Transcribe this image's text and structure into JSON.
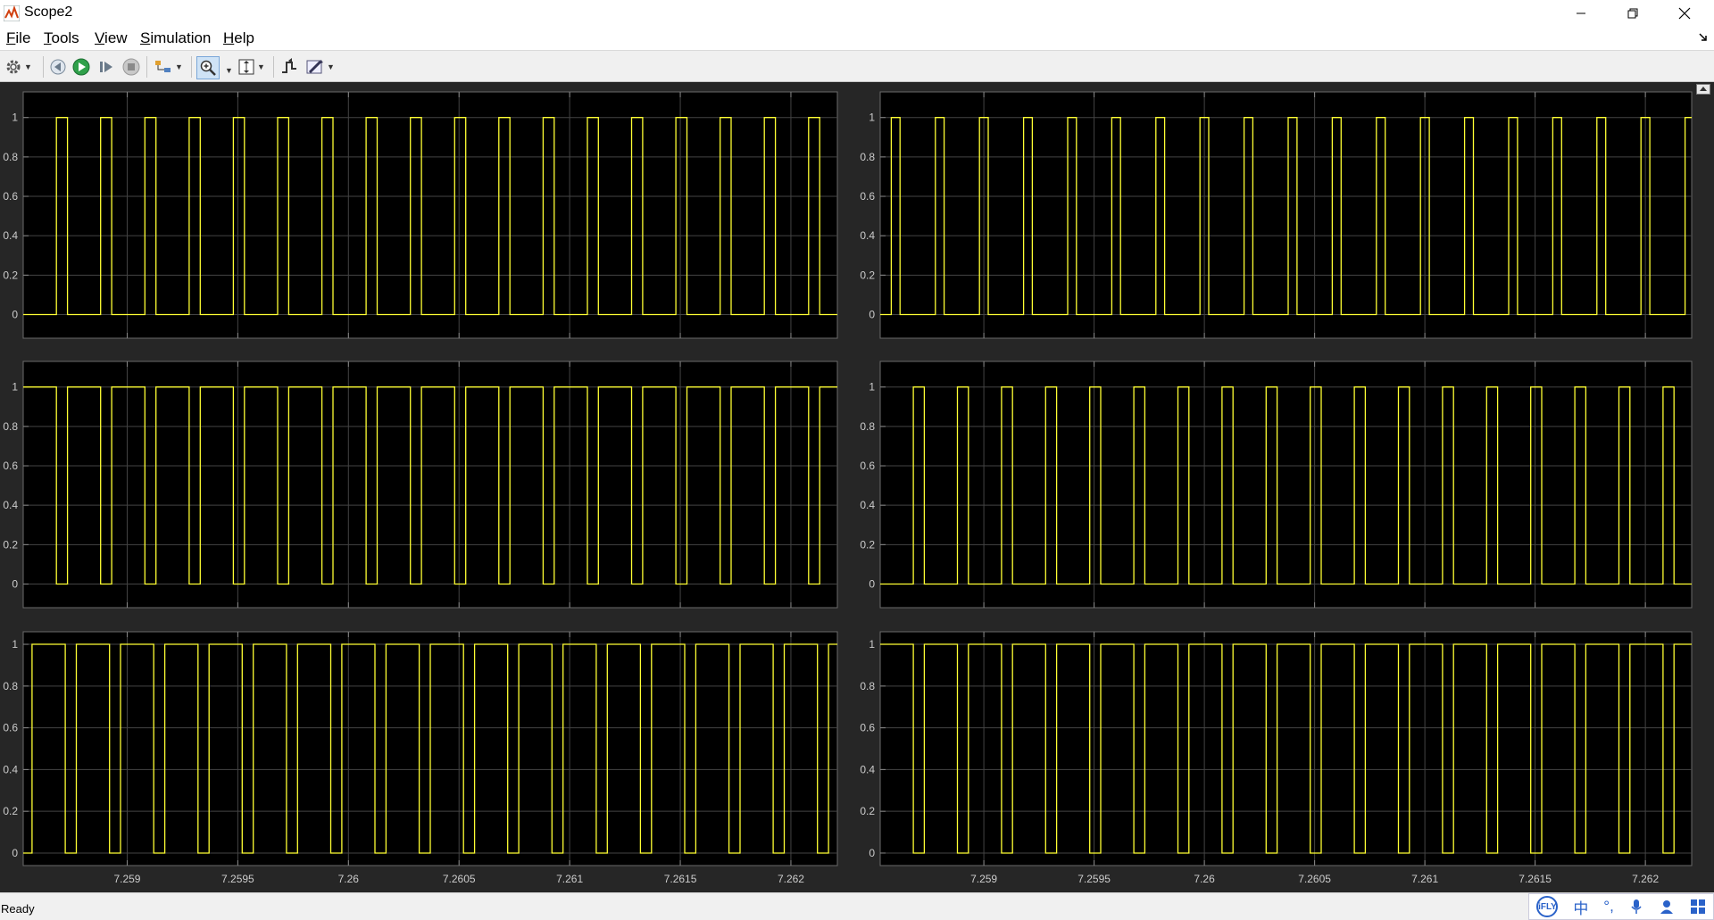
{
  "window": {
    "title": "Scope2"
  },
  "menu": [
    {
      "key": "F",
      "rest": "ile"
    },
    {
      "key": "T",
      "rest": "ools"
    },
    {
      "key": "V",
      "rest": "iew"
    },
    {
      "key": "S",
      "rest": "imulation"
    },
    {
      "key": "H",
      "rest": "elp"
    }
  ],
  "status": {
    "text": "Ready"
  },
  "ime": {
    "logo": "iFLY",
    "lang": "中"
  },
  "colors": {
    "background": "#262626",
    "axes": "#000000",
    "grid": "#444444",
    "trace": "#ffff33",
    "tick": "#cccccc"
  },
  "chart_data": [
    {
      "type": "line",
      "title": "",
      "xlabel": "",
      "ylabel": "",
      "grid": true,
      "position": "top-left",
      "ylim": [
        -0.12,
        1.13
      ],
      "yticks": [
        0,
        0.2,
        0.4,
        0.6,
        0.8,
        1
      ],
      "ytick_labels": [
        "0",
        "0.2",
        "0.4",
        "0.6",
        "0.8",
        "1"
      ],
      "xlim": [
        7.25853,
        7.26221
      ],
      "xticks": [
        7.259,
        7.2595,
        7.26,
        7.2605,
        7.261,
        7.2615,
        7.262
      ],
      "xtick_labels": [],
      "period": 0.0002,
      "pulse_start": 7.25868,
      "duty": 0.25
    },
    {
      "type": "line",
      "title": "",
      "xlabel": "",
      "ylabel": "",
      "grid": true,
      "position": "top-right",
      "ylim": [
        -0.12,
        1.13
      ],
      "yticks": [
        0,
        0.2,
        0.4,
        0.6,
        0.8,
        1
      ],
      "ytick_labels": [
        "0",
        "0.2",
        "0.4",
        "0.6",
        "0.8",
        "1"
      ],
      "xlim": [
        7.25853,
        7.26221
      ],
      "xticks": [
        7.259,
        7.2595,
        7.26,
        7.2605,
        7.261,
        7.2615,
        7.262
      ],
      "xtick_labels": [],
      "period": 0.0002,
      "pulse_start": 7.25858,
      "duty": 0.2
    },
    {
      "type": "line",
      "title": "",
      "xlabel": "",
      "ylabel": "",
      "grid": true,
      "position": "middle-left",
      "ylim": [
        -0.12,
        1.13
      ],
      "yticks": [
        0,
        0.2,
        0.4,
        0.6,
        0.8,
        1
      ],
      "ytick_labels": [
        "0",
        "0.2",
        "0.4",
        "0.6",
        "0.8",
        "1"
      ],
      "xlim": [
        7.25853,
        7.26221
      ],
      "xticks": [
        7.259,
        7.2595,
        7.26,
        7.2605,
        7.261,
        7.2615,
        7.262
      ],
      "xtick_labels": [],
      "period": 0.0002,
      "pulse_start": 7.25873,
      "duty": 0.75
    },
    {
      "type": "line",
      "title": "",
      "xlabel": "",
      "ylabel": "",
      "grid": true,
      "position": "middle-right",
      "ylim": [
        -0.12,
        1.13
      ],
      "yticks": [
        0,
        0.2,
        0.4,
        0.6,
        0.8,
        1
      ],
      "ytick_labels": [
        "0",
        "0.2",
        "0.4",
        "0.6",
        "0.8",
        "1"
      ],
      "xlim": [
        7.25853,
        7.26221
      ],
      "xticks": [
        7.259,
        7.2595,
        7.26,
        7.2605,
        7.261,
        7.2615,
        7.262
      ],
      "xtick_labels": [],
      "period": 0.0002,
      "pulse_start": 7.25868,
      "duty": 0.25
    },
    {
      "type": "line",
      "title": "",
      "xlabel": "",
      "ylabel": "",
      "grid": true,
      "position": "bottom-left",
      "ylim": [
        -0.06,
        1.06
      ],
      "yticks": [
        0,
        0.2,
        0.4,
        0.6,
        0.8,
        1
      ],
      "ytick_labels": [
        "0",
        "0.2",
        "0.4",
        "0.6",
        "0.8",
        "1"
      ],
      "xlim": [
        7.25853,
        7.26221
      ],
      "xticks": [
        7.259,
        7.2595,
        7.26,
        7.2605,
        7.261,
        7.2615,
        7.262
      ],
      "xtick_labels": [
        "7.259",
        "7.2595",
        "7.26",
        "7.2605",
        "7.261",
        "7.2615",
        "7.262"
      ],
      "period": 0.0002,
      "pulse_start": 7.25877,
      "duty": 0.75
    },
    {
      "type": "line",
      "title": "",
      "xlabel": "",
      "ylabel": "",
      "grid": true,
      "position": "bottom-right",
      "ylim": [
        -0.06,
        1.06
      ],
      "yticks": [
        0,
        0.2,
        0.4,
        0.6,
        0.8,
        1
      ],
      "ytick_labels": [
        "0",
        "0.2",
        "0.4",
        "0.6",
        "0.8",
        "1"
      ],
      "xlim": [
        7.25853,
        7.26221
      ],
      "xticks": [
        7.259,
        7.2595,
        7.26,
        7.2605,
        7.261,
        7.2615,
        7.262
      ],
      "xtick_labels": [
        "7.259",
        "7.2595",
        "7.26",
        "7.2605",
        "7.261",
        "7.2615",
        "7.262"
      ],
      "period": 0.0002,
      "pulse_start": 7.25873,
      "duty": 0.75
    }
  ]
}
